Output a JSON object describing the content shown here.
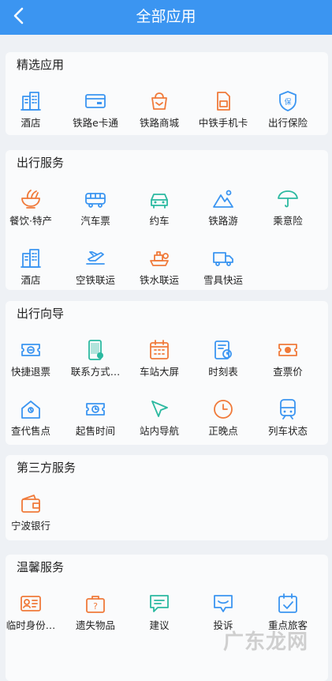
{
  "header": {
    "title": "全部应用"
  },
  "sections": [
    {
      "title": "精选应用",
      "items": [
        {
          "label": "酒店",
          "icon": "hotel-icon",
          "color": "#3b95f1"
        },
        {
          "label": "铁路e卡通",
          "icon": "card-icon",
          "color": "#3b95f1"
        },
        {
          "label": "铁路商城",
          "icon": "shop-icon",
          "color": "#f07a3a"
        },
        {
          "label": "中铁手机卡",
          "icon": "sim-card-icon",
          "color": "#f07a3a"
        },
        {
          "label": "出行保险",
          "icon": "shield-icon",
          "color": "#3b95f1"
        }
      ]
    },
    {
      "title": "出行服务",
      "items": [
        {
          "label": "餐饮·特产",
          "icon": "noodle-bowl-icon",
          "color": "#f07a3a"
        },
        {
          "label": "汽车票",
          "icon": "bus-icon",
          "color": "#3b95f1"
        },
        {
          "label": "约车",
          "icon": "car-icon",
          "color": "#2bb9a0"
        },
        {
          "label": "铁路游",
          "icon": "mountain-icon",
          "color": "#3b95f1"
        },
        {
          "label": "乘意险",
          "icon": "umbrella-icon",
          "color": "#2bb9a0"
        },
        {
          "label": "酒店",
          "icon": "hotel-icon",
          "color": "#3b95f1"
        },
        {
          "label": "空铁联运",
          "icon": "plane-icon",
          "color": "#3b95f1"
        },
        {
          "label": "铁水联运",
          "icon": "ship-icon",
          "color": "#f07a3a"
        },
        {
          "label": "雪具快运",
          "icon": "truck-icon",
          "color": "#3b95f1"
        }
      ]
    },
    {
      "title": "出行向导",
      "items": [
        {
          "label": "快捷退票",
          "icon": "ticket-refund-icon",
          "color": "#3b95f1"
        },
        {
          "label": "联系方式…",
          "icon": "phone-icon",
          "color": "#2bb9a0"
        },
        {
          "label": "车站大屏",
          "icon": "calendar-grid-icon",
          "color": "#f07a3a"
        },
        {
          "label": "时刻表",
          "icon": "timetable-icon",
          "color": "#3b95f1"
        },
        {
          "label": "查票价",
          "icon": "price-ticket-icon",
          "color": "#f07a3a"
        },
        {
          "label": "查代售点",
          "icon": "house-icon",
          "color": "#3b95f1"
        },
        {
          "label": "起售时间",
          "icon": "ticket-clock-icon",
          "color": "#3b95f1"
        },
        {
          "label": "站内导航",
          "icon": "navigation-arrow-icon",
          "color": "#2bb9a0"
        },
        {
          "label": "正晚点",
          "icon": "clock-icon",
          "color": "#f07a3a"
        },
        {
          "label": "列车状态",
          "icon": "train-icon",
          "color": "#3b95f1"
        }
      ]
    },
    {
      "title": "第三方服务",
      "items": [
        {
          "label": "宁波银行",
          "icon": "wallet-icon",
          "color": "#f07a3a"
        }
      ]
    },
    {
      "title": "温馨服务",
      "items": [
        {
          "label": "临时身份…",
          "icon": "id-card-icon",
          "color": "#f07a3a"
        },
        {
          "label": "遗失物品",
          "icon": "lost-bag-icon",
          "color": "#f07a3a"
        },
        {
          "label": "建议",
          "icon": "message-icon",
          "color": "#2bb9a0"
        },
        {
          "label": "投诉",
          "icon": "complaint-icon",
          "color": "#3b95f1"
        },
        {
          "label": "重点旅客",
          "icon": "calendar-check-icon",
          "color": "#3b95f1"
        }
      ]
    }
  ],
  "watermark": {
    "text": "广东龙网"
  }
}
